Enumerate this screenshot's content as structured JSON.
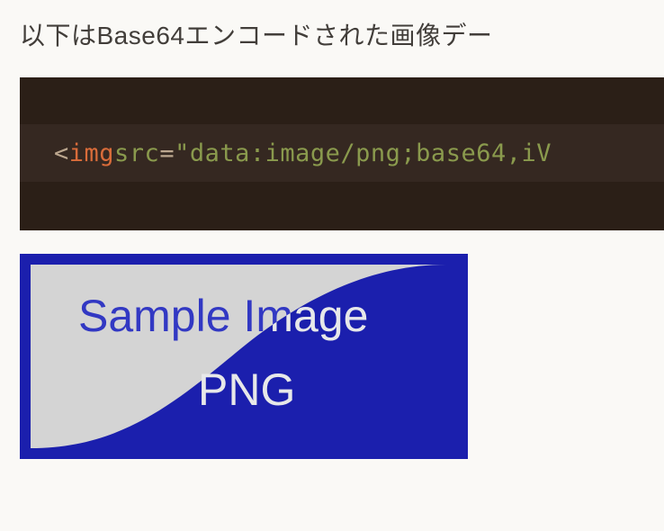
{
  "intro": "以下はBase64エンコードされた画像デー",
  "code": {
    "punct_open": "<",
    "tag": "img",
    "space1": " ",
    "attr": "src",
    "eq": "=",
    "str": "\"data:image/png;base64,iV"
  },
  "sample_image": {
    "line1": "Sample Image",
    "line2": "PNG",
    "colors": {
      "blue": "#1b1fad",
      "light": "#d4d4d4",
      "text_blue": "#3238c3",
      "text_light": "#e7e8e9"
    }
  }
}
